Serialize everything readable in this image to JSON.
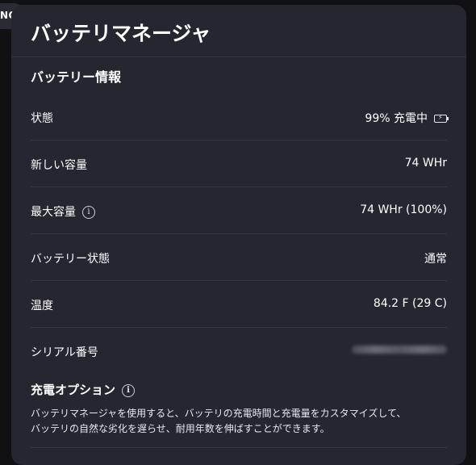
{
  "background_tab": {
    "label": "NQ"
  },
  "window": {
    "title": "バッテリマネージャ"
  },
  "battery_info": {
    "heading": "バッテリー情報",
    "rows": [
      {
        "label": "状態",
        "value": "99% 充電中"
      },
      {
        "label": "新しい容量",
        "value": "74 WHr"
      },
      {
        "label": "最大容量",
        "value": "74 WHr (100%)"
      },
      {
        "label": "バッテリー状態",
        "value": "通常"
      },
      {
        "label": "温度",
        "value": "84.2 F (29 C)"
      },
      {
        "label": "シリアル番号",
        "value": ""
      }
    ]
  },
  "charge_options": {
    "heading": "充電オプション",
    "description_line1": "バッテリマネージャを使用すると、バッテリの充電時間と充電量をカスタマイズして、",
    "description_line2": "バッテリの自然な劣化を遅らせ、耐用年数を伸ばすことができます。"
  },
  "icons": {
    "info": "info-circle-icon",
    "battery": "battery-charging-icon"
  },
  "colors": {
    "page_background": "#111114",
    "panel_background": "#262630",
    "divider": "#363743",
    "text": "#ffffff"
  }
}
